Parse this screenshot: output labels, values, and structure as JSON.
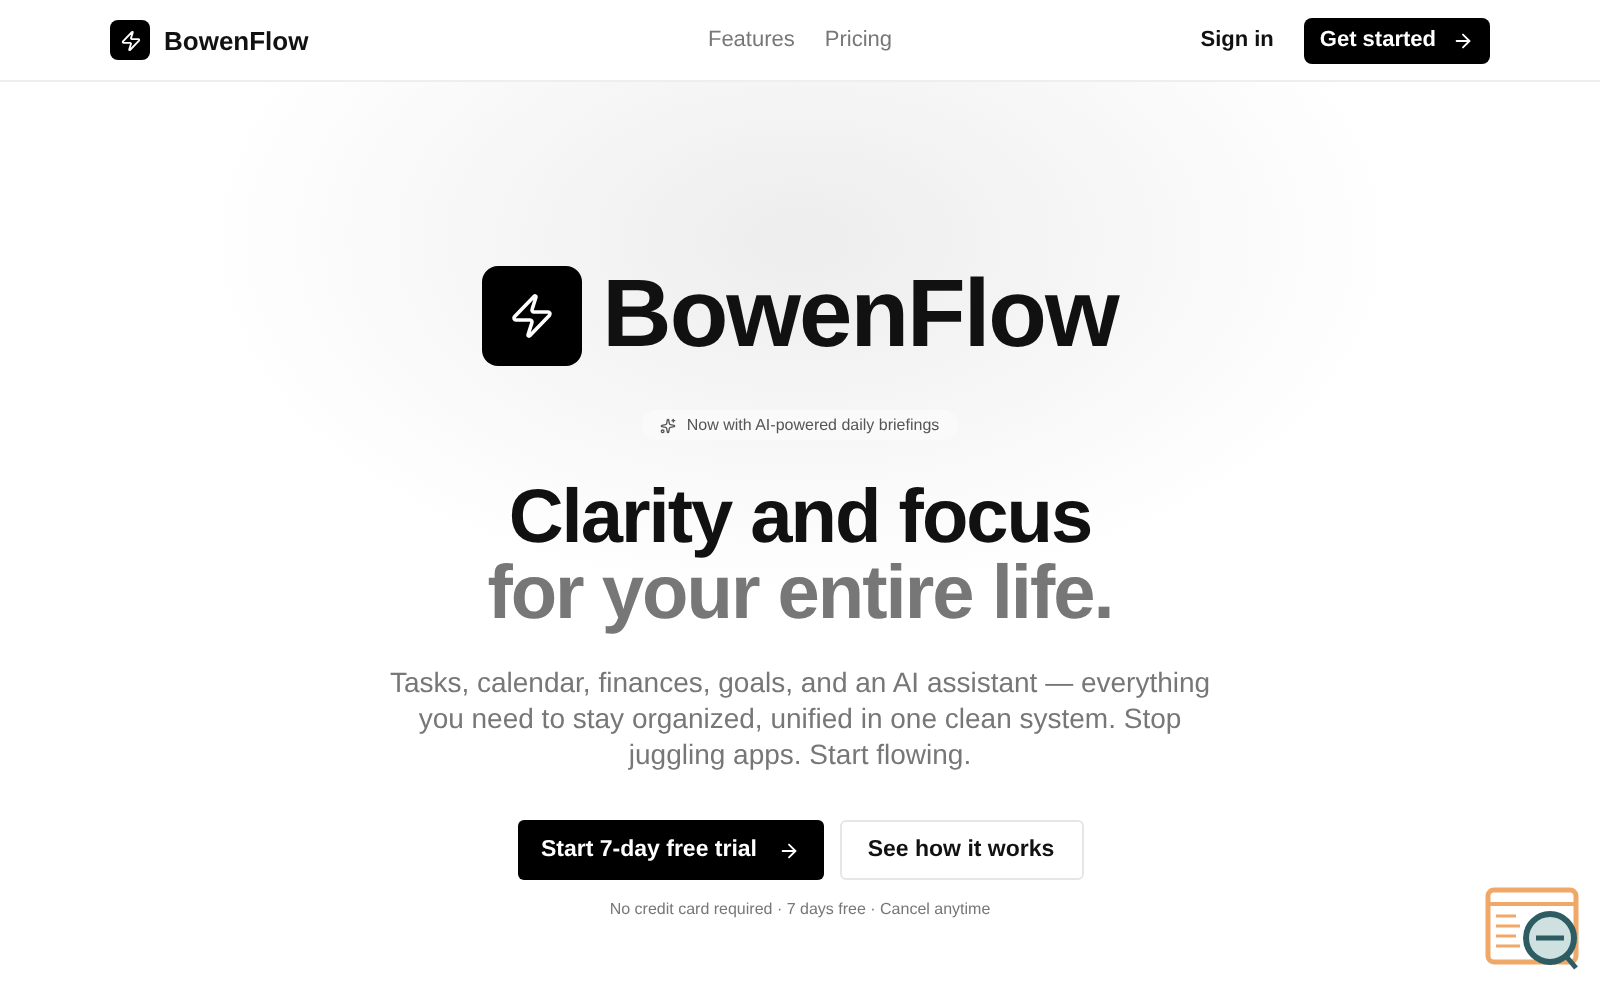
{
  "nav": {
    "brand": "BowenFlow",
    "links": [
      "Features",
      "Pricing"
    ],
    "sign_in": "Sign in",
    "cta": "Get started"
  },
  "hero": {
    "brand": "BowenFlow",
    "badge": "Now with AI-powered daily briefings",
    "title_line_1": "Clarity and focus",
    "title_line_2": "for your entire life.",
    "description": "Tasks, calendar, finances, goals, and an AI assistant — everything you need to stay organized, unified in one clean system. Stop juggling apps. Start flowing.",
    "primary_button": "Start 7-day free trial",
    "secondary_button": "See how it works",
    "note": "No credit card required · 7 days free · Cancel anytime"
  }
}
